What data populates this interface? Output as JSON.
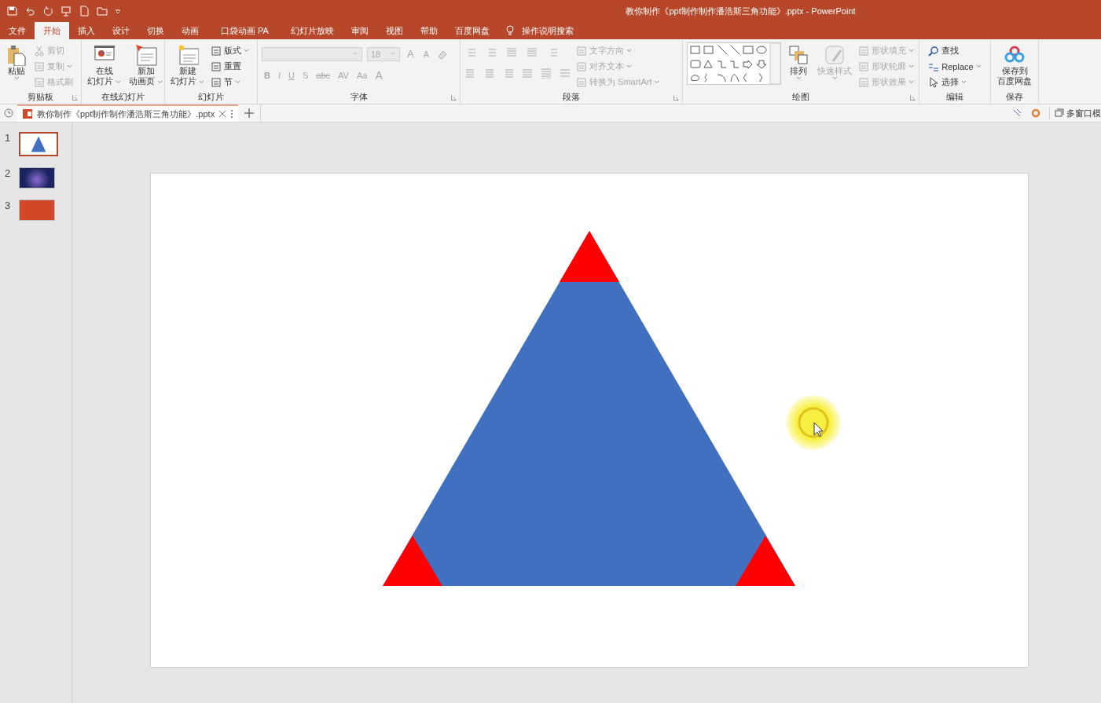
{
  "title": "教你制作《ppt制作制作潘浩斯三角功能》.pptx  -  PowerPoint",
  "menu_tabs": [
    {
      "label": "文件",
      "selected": false
    },
    {
      "label": "开始",
      "selected": true
    },
    {
      "label": "插入",
      "selected": false
    },
    {
      "label": "设计",
      "selected": false
    },
    {
      "label": "切换",
      "selected": false
    },
    {
      "label": "动画",
      "selected": false
    },
    {
      "label": "口袋动画 PA",
      "selected": false
    },
    {
      "label": "幻灯片放映",
      "selected": false
    },
    {
      "label": "审阅",
      "selected": false
    },
    {
      "label": "视图",
      "selected": false
    },
    {
      "label": "帮助",
      "selected": false
    },
    {
      "label": "百度网盘",
      "selected": false
    }
  ],
  "search_hint": "操作说明搜索",
  "ribbon": [
    {
      "label": "剪贴板",
      "launcher": true,
      "items": [
        {
          "kind": "large",
          "lines": [
            "粘贴"
          ],
          "dropdown": true,
          "disabled": false
        },
        {
          "kind": "stack",
          "entries": [
            {
              "label": "剪切",
              "dropdown": false,
              "disabled": true
            },
            {
              "label": "复制",
              "dropdown": true,
              "disabled": true
            },
            {
              "label": "格式刷",
              "dropdown": false,
              "disabled": true
            }
          ]
        }
      ]
    },
    {
      "label": "在线幻灯片",
      "launcher": false,
      "items": [
        {
          "kind": "large",
          "lines": [
            "在线",
            "幻灯片"
          ],
          "dropdown": true,
          "disabled": false
        },
        {
          "kind": "large",
          "lines": [
            "新加",
            "动画页"
          ],
          "dropdown": true,
          "disabled": false
        }
      ]
    },
    {
      "label": "幻灯片",
      "launcher": false,
      "items": [
        {
          "kind": "large",
          "lines": [
            "新建",
            "幻灯片"
          ],
          "dropdown": true,
          "disabled": false
        },
        {
          "kind": "stack",
          "entries": [
            {
              "label": "版式",
              "dropdown": true,
              "disabled": false
            },
            {
              "label": "重置",
              "dropdown": false,
              "disabled": false
            },
            {
              "label": "节",
              "dropdown": true,
              "disabled": false
            }
          ]
        }
      ]
    },
    {
      "label": "字体",
      "launcher": true,
      "items": [
        {
          "kind": "font",
          "disabled": true,
          "size": "18",
          "size_buttons": [
            "A",
            "A"
          ],
          "styles": [
            "B",
            "I",
            "U",
            "S",
            "abc",
            "AV",
            "Aa",
            "A"
          ]
        }
      ]
    },
    {
      "label": "段落",
      "launcher": true,
      "items": [
        {
          "kind": "paragraph",
          "disabled": true
        },
        {
          "kind": "stack",
          "entries": [
            {
              "label": "文字方向",
              "dropdown": true,
              "disabled": true
            },
            {
              "label": "对齐文本",
              "dropdown": true,
              "disabled": true
            },
            {
              "label": "转换为 SmartArt",
              "dropdown": true,
              "disabled": true
            }
          ]
        }
      ]
    },
    {
      "label": "绘图",
      "launcher": true,
      "items": [
        {
          "kind": "shapes"
        },
        {
          "kind": "large",
          "lines": [
            "排列"
          ],
          "dropdown": true,
          "disabled": false
        },
        {
          "kind": "large",
          "lines": [
            "快速样式"
          ],
          "dropdown": true,
          "disabled": true
        },
        {
          "kind": "stack",
          "entries": [
            {
              "label": "形状填充",
              "dropdown": true,
              "disabled": true
            },
            {
              "label": "形状轮廓",
              "dropdown": true,
              "disabled": true
            },
            {
              "label": "形状效果",
              "dropdown": true,
              "disabled": true
            }
          ]
        }
      ]
    },
    {
      "label": "编辑",
      "launcher": false,
      "items": [
        {
          "kind": "stack",
          "entries": [
            {
              "label": "查找",
              "dropdown": false,
              "disabled": false
            },
            {
              "label": "Replace",
              "dropdown": true,
              "disabled": false
            },
            {
              "label": "选择",
              "dropdown": true,
              "disabled": false
            }
          ]
        }
      ]
    },
    {
      "label": "保存",
      "launcher": false,
      "items": [
        {
          "kind": "large",
          "lines": [
            "保存到",
            "百度网盘"
          ],
          "dropdown": false,
          "disabled": false
        }
      ]
    }
  ],
  "doc_tab": {
    "label": "教你制作《ppt制作制作潘浩斯三角功能》.pptx",
    "selected": true
  },
  "window_button": "多窗口模",
  "slides": [
    {
      "number": "1",
      "selected": true
    },
    {
      "number": "2",
      "selected": false
    },
    {
      "number": "3",
      "selected": false
    }
  ]
}
